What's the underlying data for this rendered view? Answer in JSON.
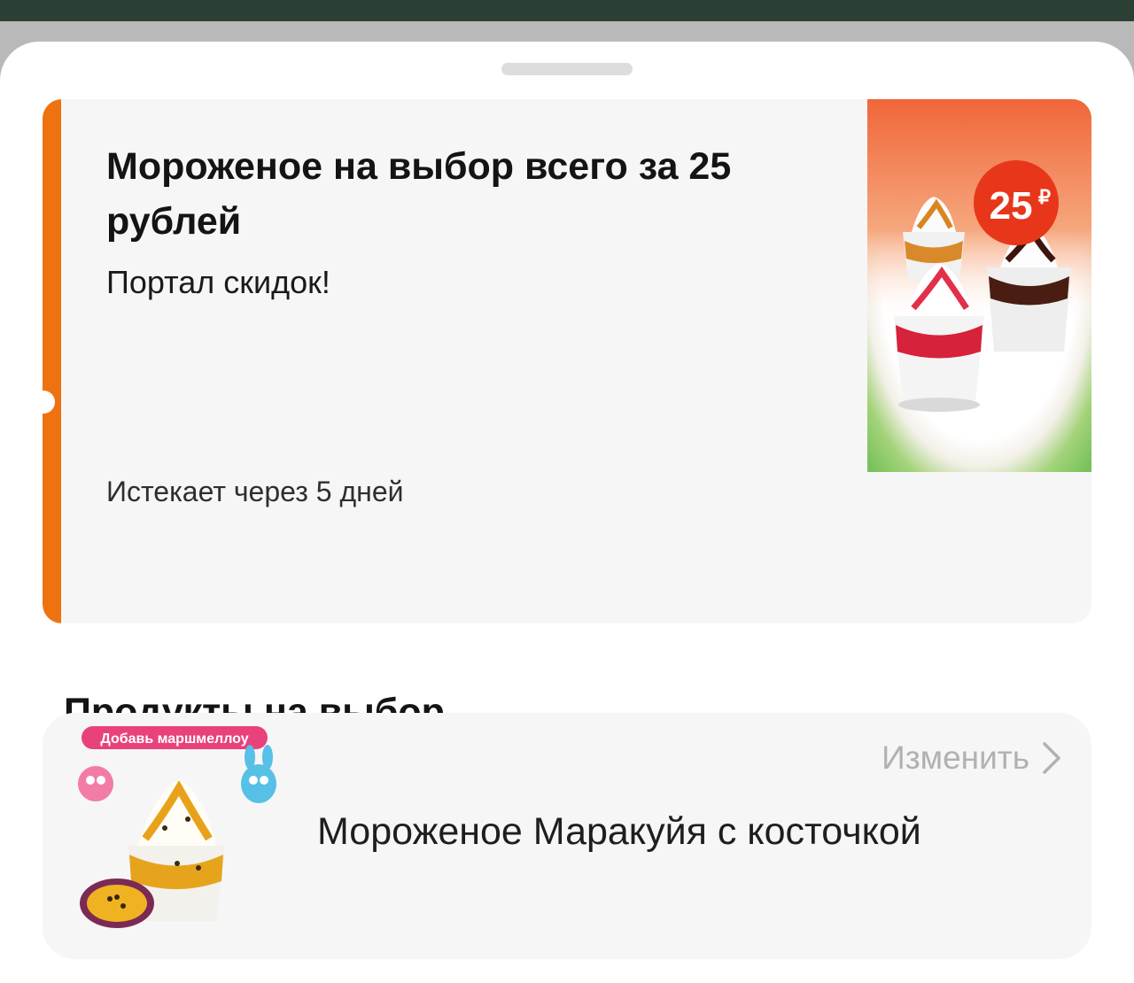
{
  "offer": {
    "title": "Мороженое на выбор всего за 25 рублей",
    "subtitle": "Портал скидок!",
    "expiry": "Истекает через 5 дней",
    "image": {
      "icon": "ice-cream-sundaes-icon",
      "price_badge": "25₽"
    }
  },
  "products": {
    "heading": "Продукты на выбор",
    "item": {
      "name": "Мороженое Маракуйя с косточкой",
      "change_label": "Изменить",
      "badge": "Добавь маршмеллоу",
      "icon": "passion-fruit-ice-cream-icon"
    }
  },
  "colors": {
    "accent": "#ef7211",
    "card_bg": "#f6f6f6",
    "muted_text": "#b1b1b1",
    "badge_pink": "#e9417c",
    "price_red": "#e8361b"
  }
}
